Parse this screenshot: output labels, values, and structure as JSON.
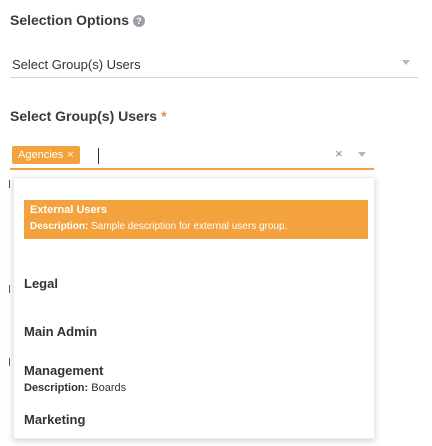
{
  "selection_options": {
    "label": "Selection Options",
    "help_icon": "question-circle-icon",
    "value": "Select Group(s) Users"
  },
  "group_users": {
    "label": "Select Group(s) Users",
    "required_mark": "*",
    "chips": [
      {
        "label": "Agencies",
        "remove": "×"
      }
    ],
    "clear": "×"
  },
  "dropdown": {
    "options": [
      {
        "title": "External Users",
        "desc_label": "Description:",
        "desc_text": "Sample description for external users group.",
        "highlighted": true
      },
      {
        "title": "Legal"
      },
      {
        "title": "Main Admin"
      },
      {
        "title": "Management",
        "desc_label": "Description:",
        "desc_text": "Boards"
      },
      {
        "title": "Marketing"
      }
    ]
  },
  "colors": {
    "accent": "#f3a23d",
    "text": "#333333",
    "muted": "#b7b7b7"
  }
}
